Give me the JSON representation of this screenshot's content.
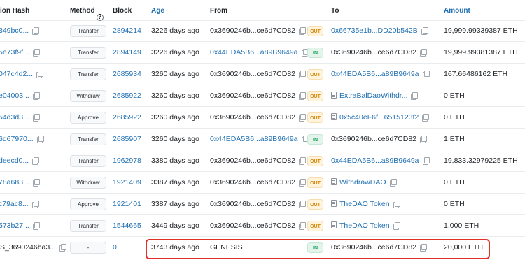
{
  "header": {
    "hash": "ion Hash",
    "method": "Method",
    "method_help_icon": "question-circle-icon",
    "block": "Block",
    "age": "Age",
    "from": "From",
    "to": "To",
    "amount": "Amount"
  },
  "rows": [
    {
      "hash": "349bc0...",
      "method": "Transfer",
      "block": "2894214",
      "age": "3226 days ago",
      "from": "0x3690246b...ce6d7CD82",
      "from_link": false,
      "dir": "OUT",
      "to": "0x66735e1b...DD20b542B",
      "to_link": true,
      "to_doc": false,
      "amount": "19,999.99339387 ETH"
    },
    {
      "hash": "5e73f9f...",
      "method": "Transfer",
      "block": "2894149",
      "age": "3226 days ago",
      "from": "0x44EDA5B6...a89B9649a",
      "from_link": true,
      "dir": "IN",
      "to": "0x3690246b...ce6d7CD82",
      "to_link": false,
      "to_doc": false,
      "amount": "19,999.99381387 ETH"
    },
    {
      "hash": "047c4d2...",
      "method": "Transfer",
      "block": "2685934",
      "age": "3260 days ago",
      "from": "0x3690246b...ce6d7CD82",
      "from_link": false,
      "dir": "OUT",
      "to": "0x44EDA5B6...a89B9649a",
      "to_link": true,
      "to_doc": false,
      "amount": "167.66486162 ETH"
    },
    {
      "hash": "e04003...",
      "method": "Withdraw",
      "block": "2685922",
      "age": "3260 days ago",
      "from": "0x3690246b...ce6d7CD82",
      "from_link": false,
      "dir": "OUT",
      "to": "ExtraBalDaoWithdr...",
      "to_link": true,
      "to_doc": true,
      "amount": "0 ETH"
    },
    {
      "hash": "54d3d3...",
      "method": "Approve",
      "block": "2685922",
      "age": "3260 days ago",
      "from": "0x3690246b...ce6d7CD82",
      "from_link": false,
      "dir": "OUT",
      "to": "0x5c40eF6f...6515123f2",
      "to_link": true,
      "to_doc": true,
      "amount": "0 ETH"
    },
    {
      "hash": "6d67970...",
      "method": "Transfer",
      "block": "2685907",
      "age": "3260 days ago",
      "from": "0x44EDA5B6...a89B9649a",
      "from_link": true,
      "dir": "IN",
      "to": "0x3690246b...ce6d7CD82",
      "to_link": false,
      "to_doc": false,
      "amount": "1 ETH"
    },
    {
      "hash": "deecd0...",
      "method": "Transfer",
      "block": "1962978",
      "age": "3380 days ago",
      "from": "0x3690246b...ce6d7CD82",
      "from_link": false,
      "dir": "OUT",
      "to": "0x44EDA5B6...a89B9649a",
      "to_link": true,
      "to_doc": false,
      "amount": "19,833.32979225 ETH"
    },
    {
      "hash": "78a683...",
      "method": "Withdraw",
      "block": "1921409",
      "age": "3387 days ago",
      "from": "0x3690246b...ce6d7CD82",
      "from_link": false,
      "dir": "OUT",
      "to": "WithdrawDAO",
      "to_link": true,
      "to_doc": true,
      "amount": "0 ETH"
    },
    {
      "hash": "c79ac8...",
      "method": "Approve",
      "block": "1921401",
      "age": "3387 days ago",
      "from": "0x3690246b...ce6d7CD82",
      "from_link": false,
      "dir": "OUT",
      "to": "TheDAO Token",
      "to_link": true,
      "to_doc": true,
      "amount": "0 ETH"
    },
    {
      "hash": "573b27...",
      "method": "Transfer",
      "block": "1544665",
      "age": "3449 days ago",
      "from": "0x3690246b...ce6d7CD82",
      "from_link": false,
      "dir": "OUT",
      "to": "TheDAO Token",
      "to_link": true,
      "to_doc": true,
      "amount": "1,000 ETH"
    },
    {
      "hash": "S_3690246ba3...",
      "method": "-",
      "block": "0",
      "age": "3743 days ago",
      "from": "GENESIS",
      "from_link": false,
      "dir": "IN",
      "to": "0x3690246b...ce6d7CD82",
      "to_link": false,
      "to_doc": false,
      "amount": "20,000 ETH"
    }
  ],
  "colors": {
    "link": "#1f6fb2",
    "highlight": "#e0312b",
    "out_badge": "#d58a0d",
    "in_badge": "#0f9e58"
  }
}
